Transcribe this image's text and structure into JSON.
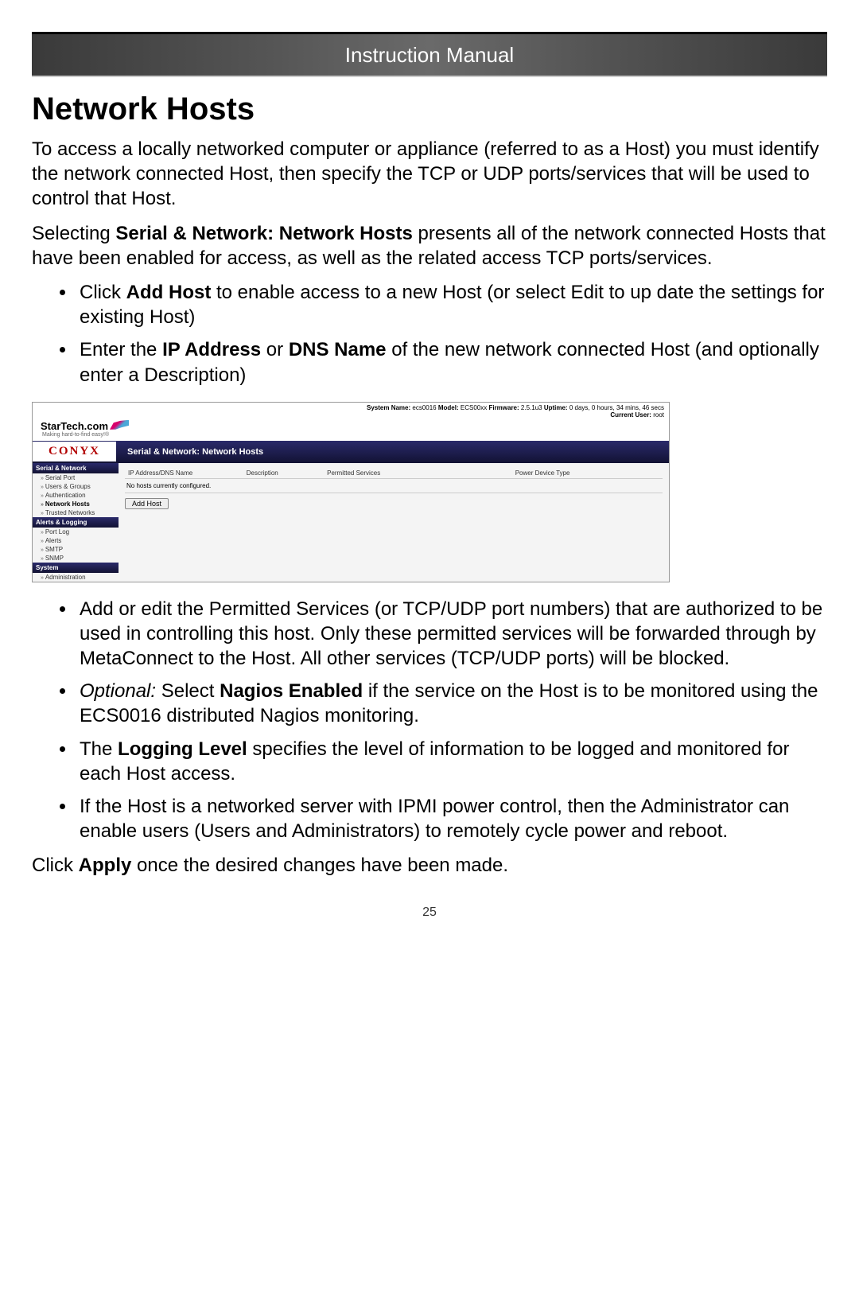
{
  "banner": "Instruction Manual",
  "heading": "Network Hosts",
  "p1": "To access a locally networked computer or appliance (referred to as a Host) you must identify the network connected Host, then specify the TCP or UDP ports/services that will be used to control that Host.",
  "p2a": "Selecting ",
  "p2b": "Serial & Network: Network Hosts",
  "p2c": " presents all of the network connected Hosts that have been enabled for access, as well as the related access TCP ports/services.",
  "b1a": "Click ",
  "b1b": "Add Host",
  "b1c": " to enable access to a new Host (or select Edit to up date the settings for existing Host)",
  "b2a": "Enter the ",
  "b2b": "IP Address",
  "b2c": " or ",
  "b2d": "DNS Name",
  "b2e": " of the new network connected Host (and optionally enter a Description)",
  "shot": {
    "topinfo_a": "System Name:",
    "topinfo_av": " ecs0016   ",
    "topinfo_b": "Model:",
    "topinfo_bv": " ECS00xx   ",
    "topinfo_c": "Firmware:",
    "topinfo_cv": " 2.5.1u3   ",
    "topinfo_d": "Uptime:",
    "topinfo_dv": " 0 days, 0 hours, 34 mins, 46 secs",
    "topinfo_e": "Current User:",
    "topinfo_ev": " root",
    "startech": "StarTech.com",
    "tagline": "Making hard-to-find easy!®",
    "conyx": "CONYX",
    "bar_title": "Serial & Network: Network Hosts",
    "side": {
      "h1": "Serial & Network",
      "i1": "Serial Port",
      "i2": "Users & Groups",
      "i3": "Authentication",
      "i4": "Network Hosts",
      "i5": "Trusted Networks",
      "h2": "Alerts & Logging",
      "i6": "Port Log",
      "i7": "Alerts",
      "i8": "SMTP",
      "i9": "SNMP",
      "h3": "System",
      "i10": "Administration"
    },
    "cols": {
      "c1": "IP Address/DNS Name",
      "c2": "Description",
      "c3": "Permitted Services",
      "c4": "Power Device Type"
    },
    "nohosts": "No hosts currently configured.",
    "addbtn": "Add Host"
  },
  "b3": "Add or edit the Permitted Services (or TCP/UDP port numbers) that are authorized to be used in controlling this host. Only these permitted services will be forwarded through by MetaConnect to the Host.  All other services (TCP/UDP ports) will be blocked.",
  "b4a": "Optional:",
  "b4b": " Select ",
  "b4c": "Nagios Enabled",
  "b4d": " if the service on the Host is to be monitored using the ECS0016 distributed Nagios monitoring.",
  "b5a": "The ",
  "b5b": "Logging Level",
  "b5c": " specifies the level of information to be logged and monitored for each Host access.",
  "b6": "If the Host is a networked server with IPMI power control, then the Administrator can enable users (Users and Administrators) to remotely cycle power and reboot.",
  "p3a": "Click ",
  "p3b": "Apply",
  "p3c": " once the desired changes have been made.",
  "pageno": "25"
}
